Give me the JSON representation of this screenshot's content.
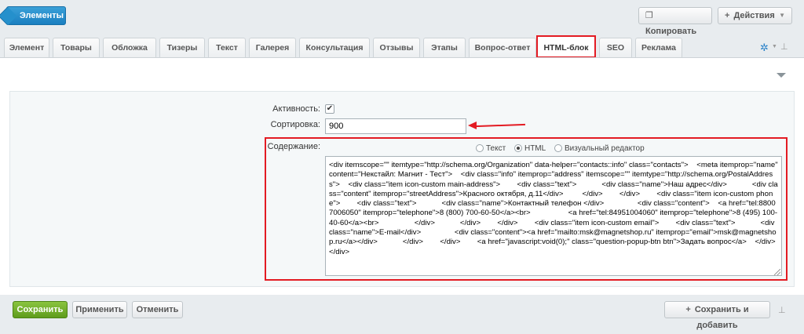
{
  "topbar": {
    "back_label": "Элементы",
    "copy_label": "Копировать",
    "actions_label": "Действия",
    "caret": "▼"
  },
  "tabs": [
    {
      "label": "Элемент"
    },
    {
      "label": "Товары"
    },
    {
      "label": "Обложка"
    },
    {
      "label": "Тизеры"
    },
    {
      "label": "Текст"
    },
    {
      "label": "Галерея"
    },
    {
      "label": "Консультация"
    },
    {
      "label": "Отзывы"
    },
    {
      "label": "Этапы"
    },
    {
      "label": "Вопрос-ответ"
    },
    {
      "label": "HTML-блок"
    },
    {
      "label": "SEO"
    },
    {
      "label": "Реклама"
    }
  ],
  "form": {
    "active_label": "Активность:",
    "active_checked": "✔",
    "sort_label": "Сортировка:",
    "sort_value": "900",
    "content_label": "Содержание:",
    "editor_modes": [
      {
        "label": "Текст",
        "selected": false
      },
      {
        "label": "HTML",
        "selected": true
      },
      {
        "label": "Визуальный редактор",
        "selected": false
      }
    ],
    "html_content": "<div itemscope=\"\" itemtype=\"http://schema.org/Organization\" data-helper=\"contacts::info\" class=\"contacts\">    <meta itemprop=\"name\" content=\"Некстайл: Магнит - Тест\">    <div class=\"info\" itemprop=\"address\" itemscope=\"\" itemtype=\"http://schema.org/PostalAddress\">    <div class=\"item icon-custom main-address\">        <div class=\"text\">            <div class=\"name\">Наш адрес</div>            <div class=\"content\" itemprop=\"streetAddress\">Красного октября, д.11</div>         </div>        </div>        <div class=\"item icon-custom phone\">        <div class=\"text\">            <div class=\"name\">Контактный телефон </div>                <div class=\"content\">    <a href=\"tel:88007006050\" itemprop=\"telephone\">8 (800) 700-60-50</a><br>                  <a href=\"tel:84951004060\" itemprop=\"telephone\">8 (495) 100-40-60</a><br>                 </div>            </div>        </div>        <div class=\"item icon-custom email\">        <div class=\"text\">            <div class=\"name\">E-mail</div>                <div class=\"content\"><a href=\"mailto:msk@magnetshop.ru\" itemprop=\"email\">msk@magnetshop.ru</a></div>            </div>        </div>        <a href=\"javascript:void(0);\" class=\"question-popup-btn btn\">Задать вопрос</a>    </div></div>"
  },
  "bottom": {
    "save_label": "Сохранить",
    "apply_label": "Применить",
    "cancel_label": "Отменить",
    "save_add_label": "Сохранить и добавить"
  },
  "colors": {
    "accent_blue": "#1a7fc0",
    "save_green": "#6aaa22",
    "highlight_red": "#e31b23"
  }
}
